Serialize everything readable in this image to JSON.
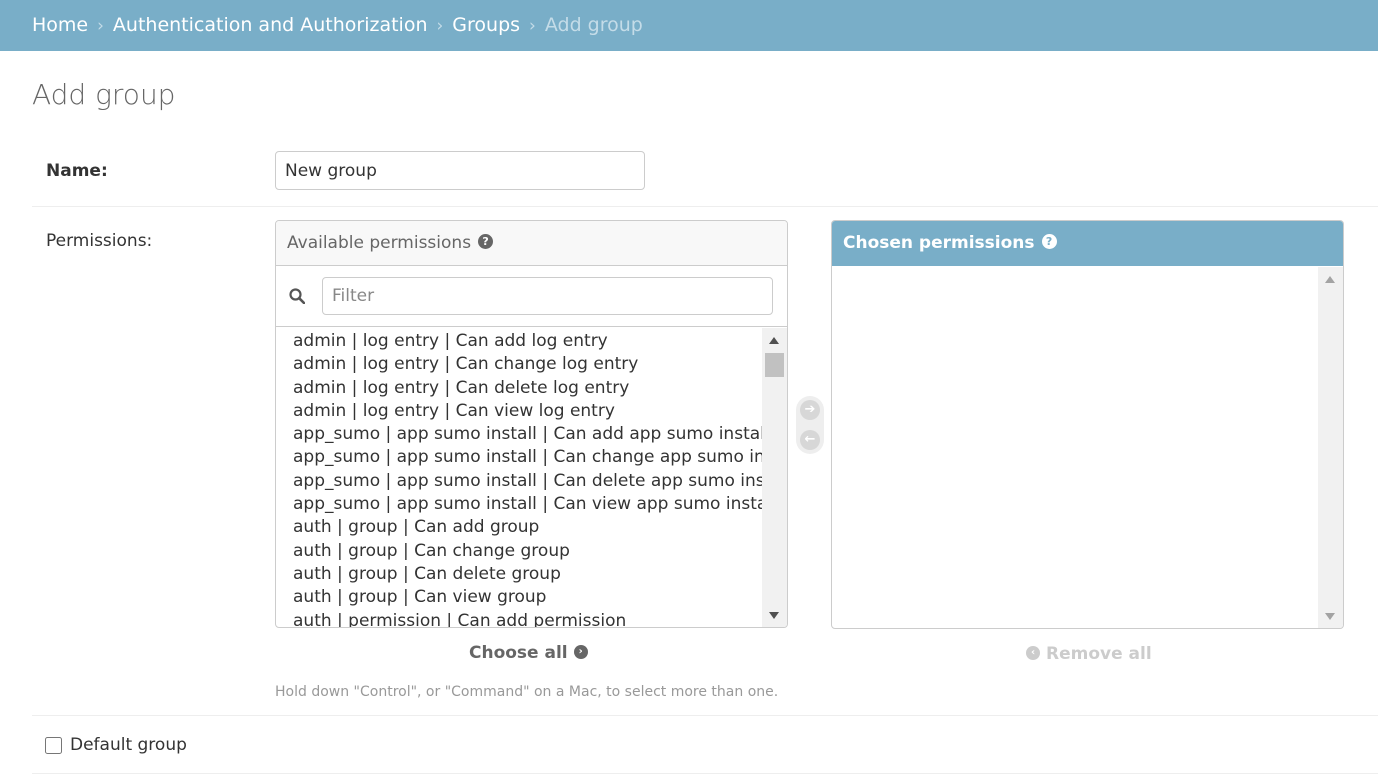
{
  "breadcrumbs": {
    "home": "Home",
    "section": "Authentication and Authorization",
    "model": "Groups",
    "current": "Add group",
    "separator": "›"
  },
  "page": {
    "title": "Add group"
  },
  "form": {
    "name_label": "Name:",
    "name_value": "New group",
    "permissions_label": "Permissions:",
    "help_text": "Hold down \"Control\", or \"Command\" on a Mac, to select more than one.",
    "default_group_label": "Default group",
    "default_group_checked": false
  },
  "available": {
    "title": "Available permissions",
    "help_glyph": "?",
    "filter_placeholder": "Filter",
    "items": [
      "admin | log entry | Can add log entry",
      "admin | log entry | Can change log entry",
      "admin | log entry | Can delete log entry",
      "admin | log entry | Can view log entry",
      "app_sumo | app sumo install | Can add app sumo install",
      "app_sumo | app sumo install | Can change app sumo install",
      "app_sumo | app sumo install | Can delete app sumo install",
      "app_sumo | app sumo install | Can view app sumo install",
      "auth | group | Can add group",
      "auth | group | Can change group",
      "auth | group | Can delete group",
      "auth | group | Can view group",
      "auth | permission | Can add permission"
    ]
  },
  "chosen": {
    "title": "Chosen permissions",
    "help_glyph": "?",
    "items": []
  },
  "actions": {
    "choose_all": "Choose all",
    "remove_all": "Remove all",
    "right_arrow": "➔",
    "left_arrow": "←"
  },
  "colors": {
    "header": "#79aec8",
    "text": "#333333",
    "muted": "#999999"
  }
}
